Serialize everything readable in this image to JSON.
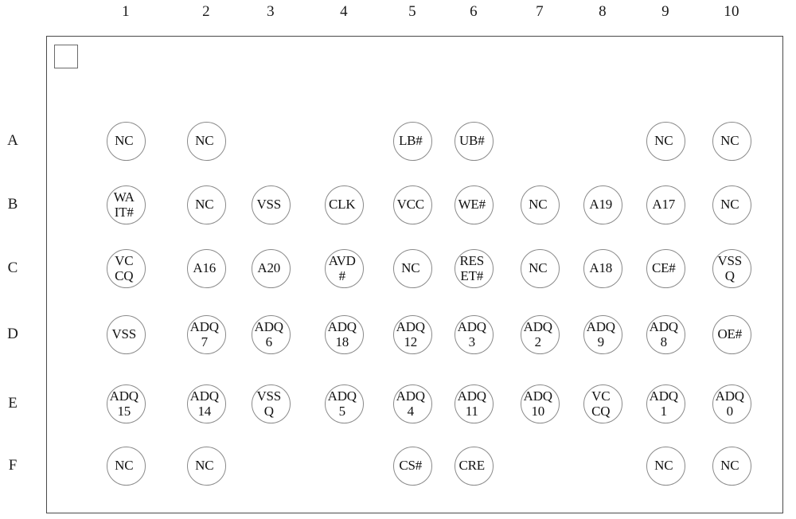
{
  "diagram": {
    "title_visible": false,
    "package_type": "bga-ball-map",
    "marker": "pin1-orientation-square",
    "columns": [
      "1",
      "2",
      "3",
      "4",
      "5",
      "6",
      "7",
      "8",
      "9",
      "10"
    ],
    "rows": [
      "A",
      "B",
      "C",
      "D",
      "E",
      "F"
    ],
    "column_x": [
      158,
      259,
      340,
      432,
      518,
      595,
      678,
      757,
      836,
      919
    ],
    "row_y": [
      177,
      257,
      337,
      420,
      507,
      585
    ],
    "colors": {
      "frame_stroke": "#4a4a4a",
      "ball_stroke": "#8a8a8a",
      "text": "#111111",
      "background": "#ffffff"
    },
    "balls": [
      {
        "id": "A1",
        "col": 1,
        "row": "A",
        "label": "NC"
      },
      {
        "id": "A2",
        "col": 2,
        "row": "A",
        "label": "NC"
      },
      {
        "id": "A5",
        "col": 5,
        "row": "A",
        "label": "LB#"
      },
      {
        "id": "A6",
        "col": 6,
        "row": "A",
        "label": "UB#"
      },
      {
        "id": "A9",
        "col": 9,
        "row": "A",
        "label": "NC"
      },
      {
        "id": "A10",
        "col": 10,
        "row": "A",
        "label": "NC"
      },
      {
        "id": "B1",
        "col": 1,
        "row": "B",
        "label": "WA\nIT#"
      },
      {
        "id": "B2",
        "col": 2,
        "row": "B",
        "label": "NC"
      },
      {
        "id": "B3",
        "col": 3,
        "row": "B",
        "label": "VSS"
      },
      {
        "id": "B4",
        "col": 4,
        "row": "B",
        "label": "CLK"
      },
      {
        "id": "B5",
        "col": 5,
        "row": "B",
        "label": "VCC"
      },
      {
        "id": "B6",
        "col": 6,
        "row": "B",
        "label": "WE#"
      },
      {
        "id": "B7",
        "col": 7,
        "row": "B",
        "label": "NC"
      },
      {
        "id": "B8",
        "col": 8,
        "row": "B",
        "label": "A19"
      },
      {
        "id": "B9",
        "col": 9,
        "row": "B",
        "label": "A17"
      },
      {
        "id": "B10",
        "col": 10,
        "row": "B",
        "label": "NC"
      },
      {
        "id": "C1",
        "col": 1,
        "row": "C",
        "label": "VC\nCQ"
      },
      {
        "id": "C2",
        "col": 2,
        "row": "C",
        "label": "A16"
      },
      {
        "id": "C3",
        "col": 3,
        "row": "C",
        "label": "A20"
      },
      {
        "id": "C4",
        "col": 4,
        "row": "C",
        "label": "AVD\n#"
      },
      {
        "id": "C5",
        "col": 5,
        "row": "C",
        "label": "NC"
      },
      {
        "id": "C6",
        "col": 6,
        "row": "C",
        "label": "RES\nET#"
      },
      {
        "id": "C7",
        "col": 7,
        "row": "C",
        "label": "NC"
      },
      {
        "id": "C8",
        "col": 8,
        "row": "C",
        "label": "A18"
      },
      {
        "id": "C9",
        "col": 9,
        "row": "C",
        "label": "CE#"
      },
      {
        "id": "C10",
        "col": 10,
        "row": "C",
        "label": "VSS\nQ"
      },
      {
        "id": "D1",
        "col": 1,
        "row": "D",
        "label": "VSS"
      },
      {
        "id": "D2",
        "col": 2,
        "row": "D",
        "label": "ADQ\n7"
      },
      {
        "id": "D3",
        "col": 3,
        "row": "D",
        "label": "ADQ\n6"
      },
      {
        "id": "D4",
        "col": 4,
        "row": "D",
        "label": "ADQ\n18"
      },
      {
        "id": "D5",
        "col": 5,
        "row": "D",
        "label": "ADQ\n12"
      },
      {
        "id": "D6",
        "col": 6,
        "row": "D",
        "label": "ADQ\n3"
      },
      {
        "id": "D7",
        "col": 7,
        "row": "D",
        "label": "ADQ\n2"
      },
      {
        "id": "D8",
        "col": 8,
        "row": "D",
        "label": "ADQ\n9"
      },
      {
        "id": "D9",
        "col": 9,
        "row": "D",
        "label": "ADQ\n8"
      },
      {
        "id": "D10",
        "col": 10,
        "row": "D",
        "label": "OE#"
      },
      {
        "id": "E1",
        "col": 1,
        "row": "E",
        "label": "ADQ\n15"
      },
      {
        "id": "E2",
        "col": 2,
        "row": "E",
        "label": "ADQ\n14"
      },
      {
        "id": "E3",
        "col": 3,
        "row": "E",
        "label": "VSS\nQ"
      },
      {
        "id": "E4",
        "col": 4,
        "row": "E",
        "label": "ADQ\n5"
      },
      {
        "id": "E5",
        "col": 5,
        "row": "E",
        "label": "ADQ\n4"
      },
      {
        "id": "E6",
        "col": 6,
        "row": "E",
        "label": "ADQ\n11"
      },
      {
        "id": "E7",
        "col": 7,
        "row": "E",
        "label": "ADQ\n10"
      },
      {
        "id": "E8",
        "col": 8,
        "row": "E",
        "label": "VC\nCQ"
      },
      {
        "id": "E9",
        "col": 9,
        "row": "E",
        "label": "ADQ\n1"
      },
      {
        "id": "E10",
        "col": 10,
        "row": "E",
        "label": "ADQ\n0"
      },
      {
        "id": "F1",
        "col": 1,
        "row": "F",
        "label": "NC"
      },
      {
        "id": "F2",
        "col": 2,
        "row": "F",
        "label": "NC"
      },
      {
        "id": "F5",
        "col": 5,
        "row": "F",
        "label": "CS#"
      },
      {
        "id": "F6",
        "col": 6,
        "row": "F",
        "label": "CRE"
      },
      {
        "id": "F9",
        "col": 9,
        "row": "F",
        "label": "NC"
      },
      {
        "id": "F10",
        "col": 10,
        "row": "F",
        "label": "NC"
      }
    ]
  }
}
